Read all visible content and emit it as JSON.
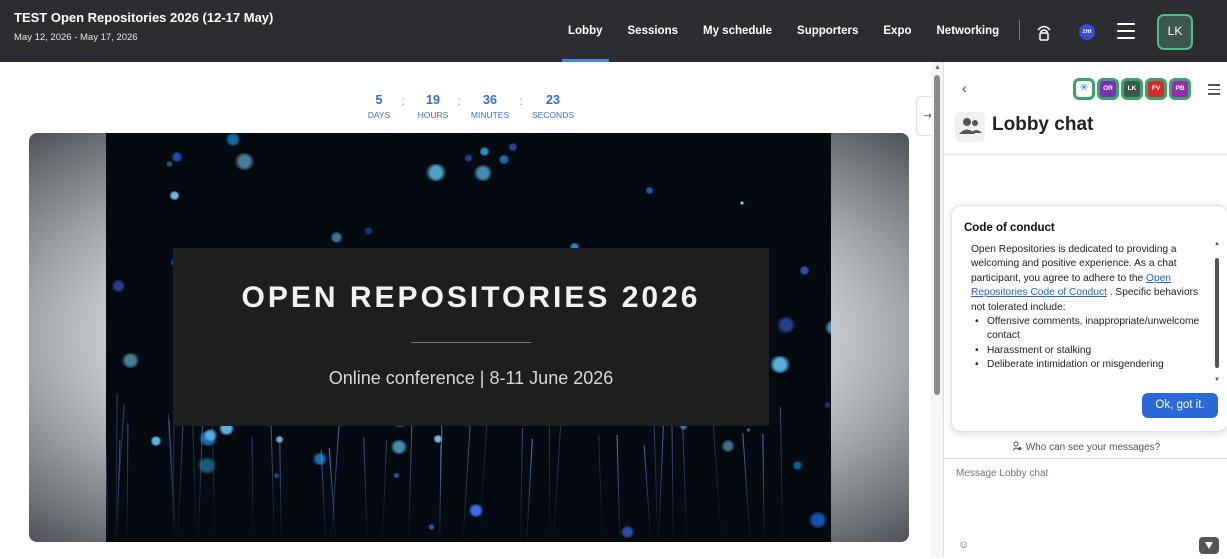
{
  "header": {
    "title": "TEST Open Repositories 2026 (12-17 May)",
    "dates": "May 12, 2026 - May 17, 2026",
    "nav": [
      {
        "label": "Lobby",
        "active": true
      },
      {
        "label": "Sessions",
        "active": false
      },
      {
        "label": "My schedule",
        "active": false
      },
      {
        "label": "Supporters",
        "active": false
      },
      {
        "label": "Expo",
        "active": false
      },
      {
        "label": "Networking",
        "active": false
      }
    ],
    "zm_badge": "zm",
    "user_initials": "LK",
    "accent": "#4a82d9"
  },
  "countdown": {
    "days": "5",
    "hours": "19",
    "minutes": "36",
    "seconds": "23",
    "days_label": "DAYS",
    "hours_label": "HOURS",
    "minutes_label": "MINUTES",
    "seconds_label": "SECONDS",
    "separator": ":"
  },
  "banner": {
    "title": "OPEN REPOSITORIES 2026",
    "subtitle": "Online conference | 8-11 June 2026"
  },
  "chat": {
    "title": "Lobby chat",
    "participants": [
      "OR",
      "LK",
      "FV",
      "PB"
    ],
    "code_of_conduct": {
      "heading": "Code of conduct",
      "intro": "Open Repositories is dedicated to providing a welcoming and positive experience. As a chat participant, you agree to adhere to the",
      "link": "Open Repositories Code of Conduct",
      "after_link": ". Specific behaviors not tolerated include:",
      "items": [
        "Offensive comments, inappropriate/unwelcome contact",
        "Harassment or stalking",
        "Deliberate intimidation or misgendering"
      ],
      "ok_label": "Ok, got it."
    },
    "visibility_text": "Who can see your messages?",
    "input_placeholder": "Message Lobby chat"
  }
}
